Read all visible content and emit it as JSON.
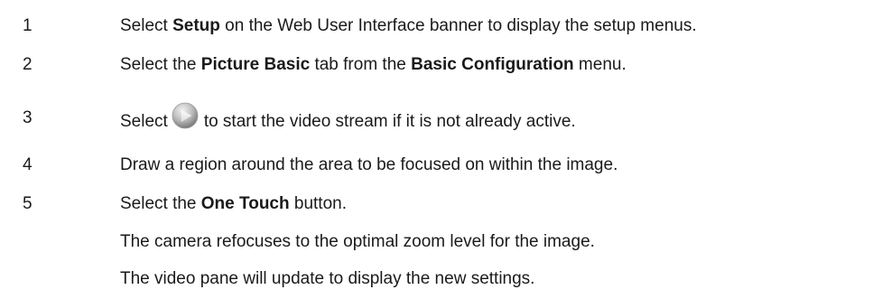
{
  "steps": [
    {
      "number": "1",
      "pre": "Select ",
      "bold1": "Setup",
      "mid": " on the Web User Interface banner to display the setup menus."
    },
    {
      "number": "2",
      "pre": "Select the ",
      "bold1": "Picture Basic",
      "mid": " tab from the ",
      "bold2": "Basic Configuration",
      "post": " menu."
    },
    {
      "number": "3",
      "pre": "Select",
      "icon": "play-icon",
      "post": "to start the video stream if it is not already active."
    },
    {
      "number": "4",
      "text": "Draw a region around the area to be focused on within the image."
    },
    {
      "number": "5",
      "pre": "Select the ",
      "bold1": "One Touch",
      "post": " button."
    }
  ],
  "notes": [
    "The camera refocuses to the optimal zoom level for the image.",
    "The video pane will update to display the new settings."
  ],
  "colors": {
    "text": "#1a1a1a",
    "icon_gradient_light": "#e6e6e6",
    "icon_gradient_dark": "#8a8a8a"
  }
}
